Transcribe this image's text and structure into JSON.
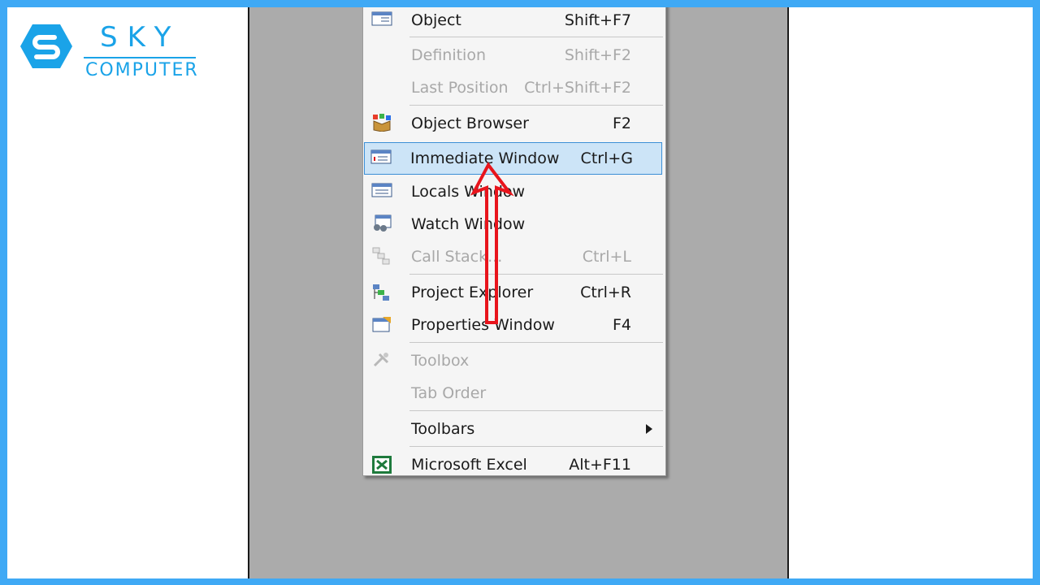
{
  "brand": {
    "line1": "SKY",
    "line2": "COMPUTER",
    "color": "#1aa3e8"
  },
  "menu": {
    "items": [
      {
        "label": "Object",
        "shortcut": "Shift+F7",
        "enabled": true,
        "icon": "object-icon"
      },
      {
        "label": "Definition",
        "shortcut": "Shift+F2",
        "enabled": false,
        "icon": ""
      },
      {
        "label": "Last Position",
        "shortcut": "Ctrl+Shift+F2",
        "enabled": false,
        "icon": ""
      },
      {
        "label": "Object Browser",
        "shortcut": "F2",
        "enabled": true,
        "icon": "object-browser-icon"
      },
      {
        "label": "Immediate Window",
        "shortcut": "Ctrl+G",
        "enabled": true,
        "highlighted": true,
        "icon": "immediate-window-icon"
      },
      {
        "label": "Locals Window",
        "shortcut": "",
        "enabled": true,
        "icon": "locals-window-icon"
      },
      {
        "label": "Watch Window",
        "shortcut": "",
        "enabled": true,
        "icon": "watch-window-icon"
      },
      {
        "label": "Call Stack...",
        "shortcut": "Ctrl+L",
        "enabled": false,
        "icon": "call-stack-icon"
      },
      {
        "label": "Project Explorer",
        "shortcut": "Ctrl+R",
        "enabled": true,
        "icon": "project-explorer-icon"
      },
      {
        "label": "Properties Window",
        "shortcut": "F4",
        "enabled": true,
        "icon": "properties-window-icon"
      },
      {
        "label": "Toolbox",
        "shortcut": "",
        "enabled": false,
        "icon": "toolbox-icon"
      },
      {
        "label": "Tab Order",
        "shortcut": "",
        "enabled": false,
        "icon": ""
      },
      {
        "label": "Toolbars",
        "shortcut": "",
        "enabled": true,
        "submenu": true,
        "icon": ""
      },
      {
        "label": "Microsoft Excel",
        "shortcut": "Alt+F11",
        "enabled": true,
        "icon": "excel-icon"
      }
    ]
  },
  "colors": {
    "frame": "#3fa9f5",
    "highlight_bg": "#cce4f7",
    "highlight_border": "#3c8fd6",
    "arrow": "#e8141c",
    "disabled_text": "#a8a8a8"
  }
}
